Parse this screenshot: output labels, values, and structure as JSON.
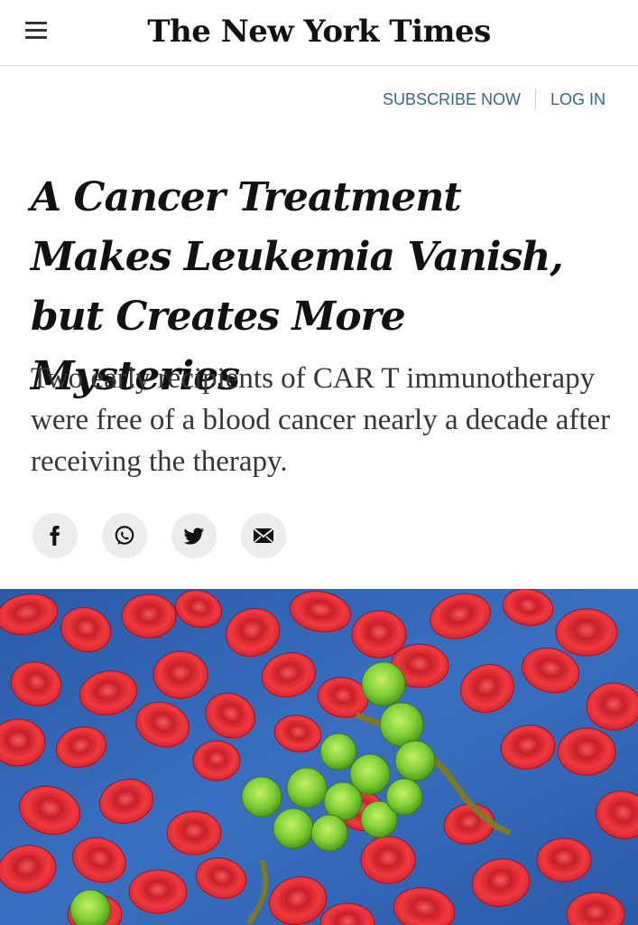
{
  "header": {
    "logo_text": "The New York Times",
    "menu_icon": "hamburger-menu-icon"
  },
  "auth": {
    "subscribe_label": "SUBSCRIBE NOW",
    "login_label": "LOG IN"
  },
  "article": {
    "headline": "A Cancer Treatment Makes Leukemia Vanish, but Creates More Mysteries",
    "summary": "Two early recipients of CAR T immunotherapy were free of a blood cancer nearly a decade after receiving the therapy."
  },
  "share": {
    "icons": [
      "facebook-icon",
      "whatsapp-icon",
      "twitter-icon",
      "email-icon"
    ]
  },
  "colors": {
    "link": "#326891",
    "image_background": "#2f64b0",
    "red_cells": "#e5303a",
    "t_cells": "#7fd13a"
  }
}
